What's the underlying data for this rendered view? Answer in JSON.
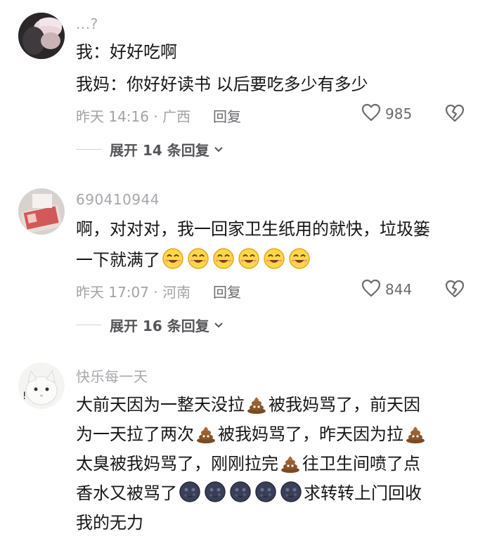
{
  "comments": [
    {
      "username": "...?",
      "lines": [
        "我：好好吃啊",
        "我妈：你好好读书 以后要吃多少有多少"
      ],
      "meta": "昨天 14:16 · 广西",
      "reply_label": "回复",
      "likes": "985",
      "expand_label": "展开 14 条回复"
    },
    {
      "username": "690410944",
      "line1": "啊，对对对，我一回家卫生纸用的就快，垃圾篓",
      "line2_text": "一下就满了",
      "emoji_name": "smile-icon",
      "meta": "昨天 17:07 · 河南",
      "reply_label": "回复",
      "likes": "844",
      "expand_label": "展开 16 条回复"
    },
    {
      "username": "快乐每一天",
      "l1a": "大前天因为一整天没拉",
      "l1b": "被我妈骂了，前天因",
      "l2a": "为一天拉了两次",
      "l2b": "被我妈骂了，昨天因为拉",
      "l3a": "太臭被我妈骂了，刚刚拉完",
      "l3b": "往卫生间喷了点",
      "l4a": "香水又被骂了",
      "l4b": "求转转上门回收",
      "l5": "我的无力",
      "emoji_poop": "poop-icon",
      "emoji_moon": "new-moon-face-icon"
    }
  ],
  "colors": {
    "text": "#161616",
    "meta": "#a2a2a8",
    "action": "#6b6b70",
    "background": "#ffffff"
  }
}
